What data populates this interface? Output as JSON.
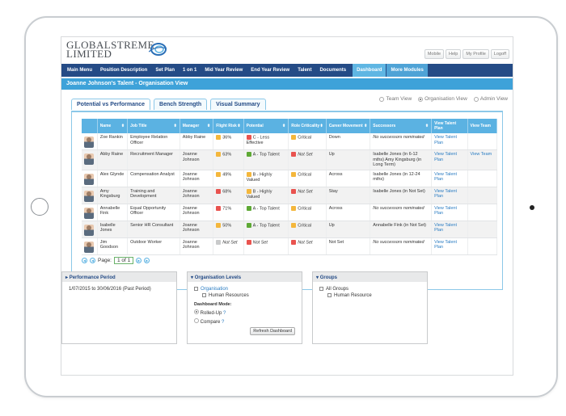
{
  "header": {
    "logo_line1": "GLOBALSTREME",
    "logo_line2": "LIMITED",
    "top_links": [
      "Mobile",
      "Help",
      "My Profile",
      "Logoff"
    ]
  },
  "nav": {
    "items": [
      "Main Menu",
      "Position Description",
      "Set Plan",
      "1 on 1",
      "Mid Year Review",
      "End Year Review",
      "Talent",
      "Documents"
    ],
    "active": "Dashboard",
    "more": "More Modules"
  },
  "page_title": "Joanne Johnson's Talent - Organisation View",
  "tabs": [
    "Potential vs Performance",
    "Bench Strength",
    "Visual Summary"
  ],
  "view_options": [
    "Team View",
    "Organisation View",
    "Admin View"
  ],
  "table": {
    "headers": [
      "Name",
      "Job Title",
      "Manager",
      "Flight Risk",
      "Potential",
      "Role Criticality",
      "Career Movement",
      "Successors",
      "View Talent Plan",
      "View Team"
    ],
    "rows": [
      {
        "name": "Zoe Rankin",
        "job": "Employee Relation Officer",
        "manager": "Abby Raine",
        "flight": "36%",
        "flight_color": "#f4b73c",
        "potential": "C - Less Effective",
        "potential_color": "#e9534f",
        "crit": "Critical",
        "crit_color": "#f4b73c",
        "career": "Down",
        "successors": "No successors nominated",
        "succ_italic": true,
        "plan": "View Talent Plan",
        "team": ""
      },
      {
        "name": "Abby Raine",
        "job": "Recruitment Manager",
        "manager": "Joanne Johnson",
        "flight": "63%",
        "flight_color": "#f4b73c",
        "potential": "A - Top Talent",
        "potential_color": "#5ea935",
        "crit": "Not Set",
        "crit_color": "#e9534f",
        "career": "Up",
        "successors": "Isabelle Jones (in 6-12 mths) Amy Kingsburg (in Long Term)",
        "succ_italic": false,
        "plan": "View Talent Plan",
        "team": "View Team"
      },
      {
        "name": "Alex Glynde",
        "job": "Compensation Analyst",
        "manager": "Joanne Johnson",
        "flight": "49%",
        "flight_color": "#f4b73c",
        "potential": "B - Highly Valued",
        "potential_color": "#f4b73c",
        "crit": "Critical",
        "crit_color": "#f4b73c",
        "career": "Across",
        "successors": "Isabelle Jones (in 12-24 mths)",
        "succ_italic": false,
        "plan": "View Talent Plan",
        "team": ""
      },
      {
        "name": "Amy Kingsburg",
        "job": "Training and Development",
        "manager": "Joanne Johnson",
        "flight": "68%",
        "flight_color": "#e9534f",
        "potential": "B - Highly Valued",
        "potential_color": "#f4b73c",
        "crit": "Not Set",
        "crit_color": "#e9534f",
        "career": "Stay",
        "successors": "Isabelle Jones (in Not Set)",
        "succ_italic": false,
        "plan": "View Talent Plan",
        "team": ""
      },
      {
        "name": "Annabelle Fink",
        "job": "Equal Opportunity Officer",
        "manager": "Joanne Johnson",
        "flight": "71%",
        "flight_color": "#e9534f",
        "potential": "A - Top Talent",
        "potential_color": "#5ea935",
        "crit": "Critical",
        "crit_color": "#f4b73c",
        "career": "Across",
        "successors": "No successors nominated",
        "succ_italic": true,
        "plan": "View Talent Plan",
        "team": ""
      },
      {
        "name": "Isabelle Jones",
        "job": "Senior HR Consultant",
        "manager": "Joanne Johnson",
        "flight": "50%",
        "flight_color": "#f4b73c",
        "potential": "A - Top Talent",
        "potential_color": "#5ea935",
        "crit": "Critical",
        "crit_color": "#f4b73c",
        "career": "Up",
        "successors": "Annabelle Fink (in Not Set)",
        "succ_italic": false,
        "plan": "View Talent Plan",
        "team": ""
      },
      {
        "name": "Jim Goodson",
        "job": "Outdoor Worker",
        "manager": "Joanne Johnson",
        "flight": "Not Set",
        "flight_color": "#c9cacb",
        "potential": "Not Set",
        "potential_color": "#e9534f",
        "crit": "Not Set",
        "crit_color": "#e9534f",
        "career": "Not Set",
        "successors": "No successors nominated",
        "succ_italic": true,
        "plan": "View Talent Plan",
        "team": ""
      }
    ]
  },
  "pager": {
    "label": "Page:",
    "value": "1 of 1"
  },
  "panels": {
    "performance": {
      "title": "Performance Period",
      "value": "1/07/2015 to 30/06/2016 (Past Period)"
    },
    "org": {
      "title": "Organisation Levels",
      "root": "Organisation",
      "child": "Human Resources",
      "mode_label": "Dashboard Mode:",
      "mode1": "Rolled-Up",
      "mode2": "Compare",
      "refresh": "Refresh Dashboard"
    },
    "groups": {
      "title": "Groups",
      "root": "All Groups",
      "child": "Human Resource"
    }
  }
}
